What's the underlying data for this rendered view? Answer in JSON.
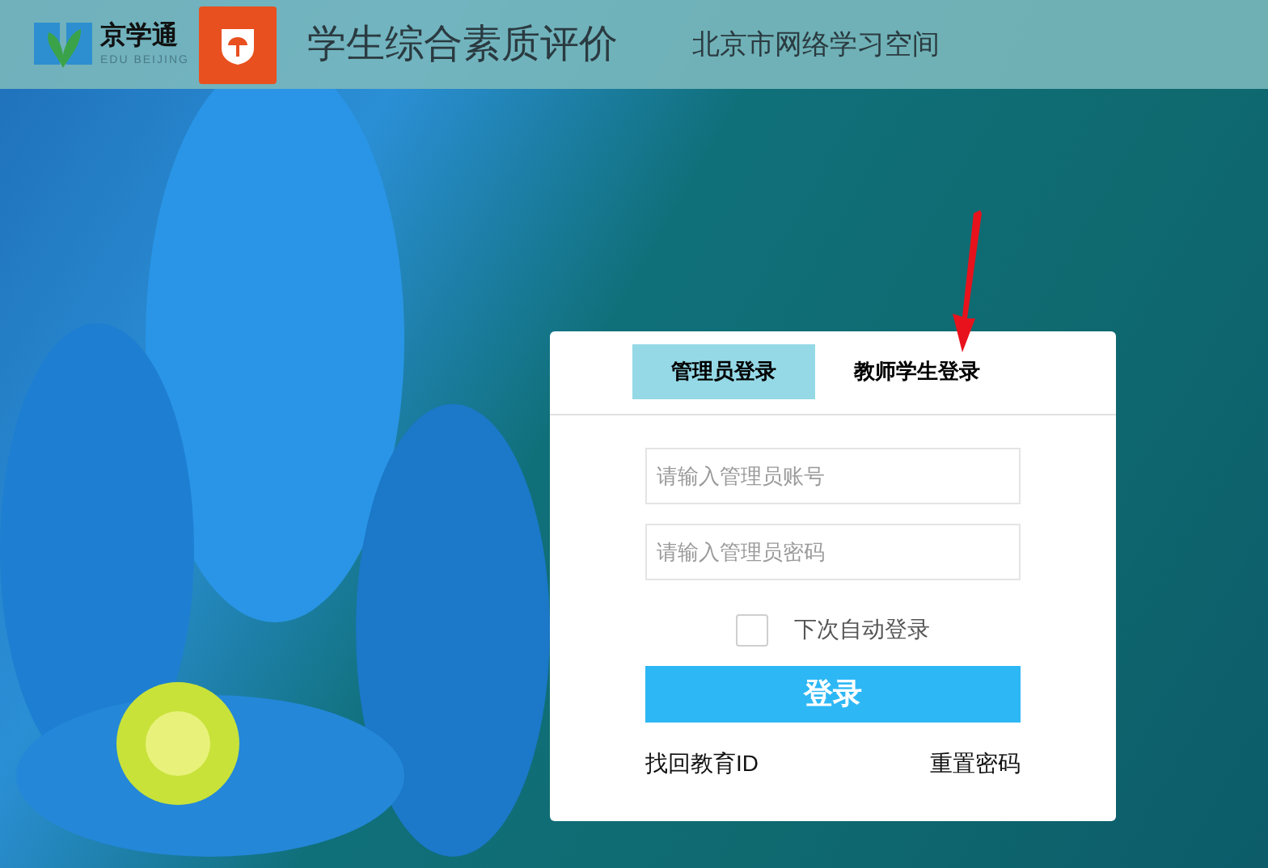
{
  "header": {
    "brand": "京学通",
    "brand_sub": "EDU BEIJING",
    "title": "学生综合素质评价",
    "subtitle": "北京市网络学习空间"
  },
  "login": {
    "tabs": [
      {
        "label": "管理员登录",
        "selected": true
      },
      {
        "label": "教师学生登录",
        "selected": false
      }
    ],
    "account": {
      "placeholder": "请输入管理员账号"
    },
    "password": {
      "placeholder": "请输入管理员密码"
    },
    "remember": {
      "label": "下次自动登录",
      "checked": false
    },
    "submit": "登录",
    "links": [
      "找回教育ID",
      "重置密码"
    ]
  }
}
